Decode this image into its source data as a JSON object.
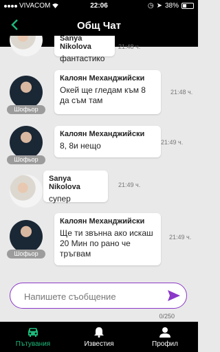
{
  "status": {
    "carrier": "VIVACOM",
    "time": "22:06",
    "battery": "38%"
  },
  "header": {
    "title": "Общ Чат"
  },
  "messages": [
    {
      "sender": "Sanya Nikolova",
      "text": "фантастико",
      "time": "21:48 ч.",
      "role": ""
    },
    {
      "sender": "Калоян Механджийски",
      "text": "Окей ще гледам към 8 да съм там",
      "time": "21:48 ч.",
      "role": "Шофьор"
    },
    {
      "sender": "Калоян Механджийски",
      "text": "8, 8и нещо",
      "time": "21:49 ч.",
      "role": "Шофьор"
    },
    {
      "sender": "Sanya Nikolova",
      "text": "супер",
      "time": "21:49 ч.",
      "role": ""
    },
    {
      "sender": "Калоян Механджийски",
      "text": "Ще ти звънна ако искаш 20 Мин по рано че тръгвам",
      "time": "21:49 ч.",
      "role": "Шофьор"
    }
  ],
  "composer": {
    "placeholder": "Напишете съобщение",
    "counter": "0/250"
  },
  "tabs": [
    {
      "label": "Пътувания",
      "icon": "car-icon",
      "active": true
    },
    {
      "label": "Известия",
      "icon": "bell-icon",
      "active": false
    },
    {
      "label": "Профил",
      "icon": "user-icon",
      "active": false
    }
  ],
  "colors": {
    "accent": "#1db97a",
    "composer_border": "#8b37c9",
    "send": "#8b37c9"
  }
}
